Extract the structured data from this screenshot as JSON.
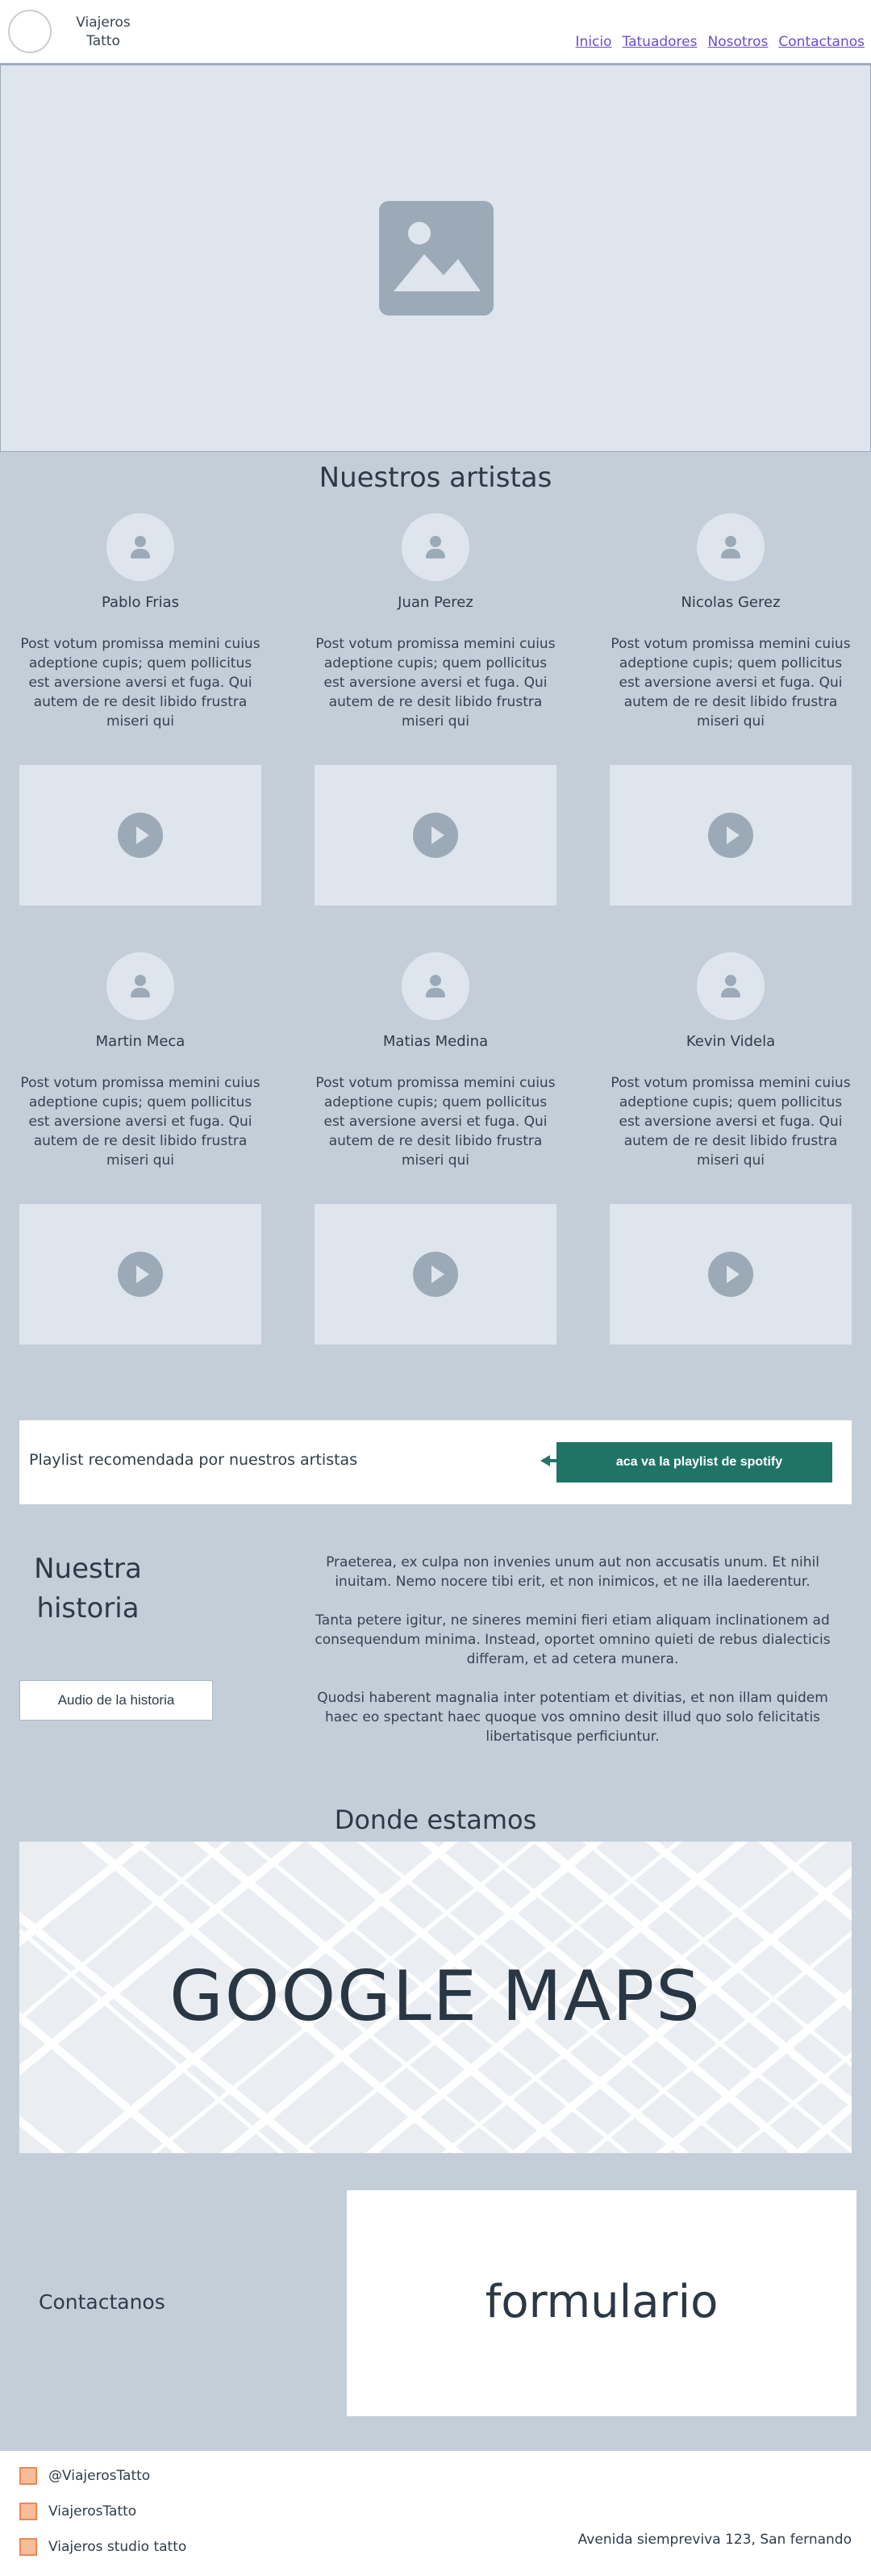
{
  "header": {
    "brand": "Viajeros\nTatto",
    "nav": [
      "Inicio",
      "Tatuadores",
      "Nosotros",
      "Contactanos"
    ]
  },
  "artists_section": {
    "title": "Nuestros artistas",
    "artists": [
      {
        "name": "Pablo Frias",
        "desc": "Post votum promissa memini cuius adeptione cupis; quem pollicitus est aversione aversi et fuga. Qui autem de re desit libido frustra miseri qui"
      },
      {
        "name": "Juan Perez",
        "desc": "Post votum promissa memini cuius adeptione cupis; quem pollicitus est aversione aversi et fuga. Qui autem de re desit libido frustra miseri qui"
      },
      {
        "name": "Nicolas Gerez",
        "desc": "Post votum promissa memini cuius adeptione cupis; quem pollicitus est aversione aversi et fuga. Qui autem de re desit libido frustra miseri qui"
      },
      {
        "name": "Martin Meca",
        "desc": "Post votum promissa memini cuius adeptione cupis; quem pollicitus est aversione aversi et fuga. Qui autem de re desit libido frustra miseri qui"
      },
      {
        "name": "Matias Medina",
        "desc": "Post votum promissa memini cuius adeptione cupis; quem pollicitus est aversione aversi et fuga. Qui autem de re desit libido frustra miseri qui"
      },
      {
        "name": "Kevin Videla",
        "desc": "Post votum promissa memini cuius adeptione cupis; quem pollicitus est aversione aversi et fuga. Qui autem de re desit libido frustra miseri qui"
      }
    ]
  },
  "playlist": {
    "label": "Playlist recomendada por nuestros artistas",
    "button": "aca va la playlist de spotify"
  },
  "historia": {
    "title": "Nuestra\nhistoria",
    "audio_button": "Audio de la historia",
    "paragraphs": [
      "Praeterea, ex culpa non invenies unum aut non accusatis unum. Et nihil inuitam. Nemo nocere tibi erit, et non inimicos, et ne illa laederentur.",
      "Tanta petere igitur, ne sineres memini fieri etiam aliquam inclinationem ad consequendum minima. Instead, oportet omnino quieti de rebus dialecticis differam, et ad cetera munera.",
      "Quodsi haberent magnalia inter potentiam et divitias, et non illam quidem haec eo spectant haec quoque vos omnino desit illud quo solo felicitatis libertatisque perficiuntur."
    ]
  },
  "location": {
    "title": "Donde estamos",
    "map_label": "GOOGLE MAPS"
  },
  "contact": {
    "label": "Contactanos",
    "form_label": "formulario"
  },
  "footer": {
    "socials": [
      "@ViajerosTatto",
      "ViajerosTatto",
      "Viajeros studio tatto"
    ],
    "address": "Avenida siempreviva 123, San fernando"
  },
  "colors": {
    "page_bg": "#c3ced8",
    "placeholder_bg": "#dfe5ed",
    "icon_gray": "#9caab7",
    "accent_green": "#1f7466",
    "link": "#6a4bd2",
    "social_icon": "#f7bd98"
  },
  "icons": {
    "hero": "image-icon",
    "avatar": "user-icon",
    "video": "play-icon",
    "playlist_arrow": "arrow-left-icon",
    "social": "square-icon"
  }
}
